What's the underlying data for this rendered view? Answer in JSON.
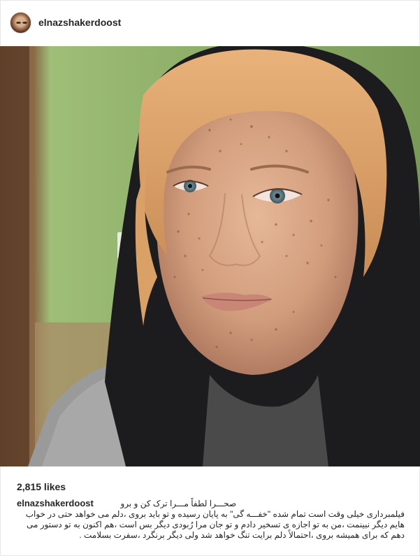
{
  "post": {
    "username": "elnazshakerdoost",
    "likes": "2,815 likes",
    "caption_title": "صحـــرا لطفاً مـــرا ترک کن و برو",
    "caption_body": "فیلمبرداری خیلی وقت است تمام شده \"خفـــه گی\" به پایان رسیده و تو باید بروی ،دلم می خواهد حتی در خواب هایم دیگر نبینمت ،من به تو اجازه ی تسخیر دادم و تو جان مرا رُبودی دیگر بس است ،هم اکنون به تو دستور می دهم که برای همیشه بروی ،احتمالاً دلم برایت تنگ خواهد شد ولی دیگر برنگرد ،سفرت بسلامت ."
  },
  "colors": {
    "wall": "#8fb36a",
    "scarf": "#1c1c1f",
    "hair": "#d9a56d",
    "skin": "#d8a686"
  },
  "icons": {
    "avatar": "avatar"
  }
}
